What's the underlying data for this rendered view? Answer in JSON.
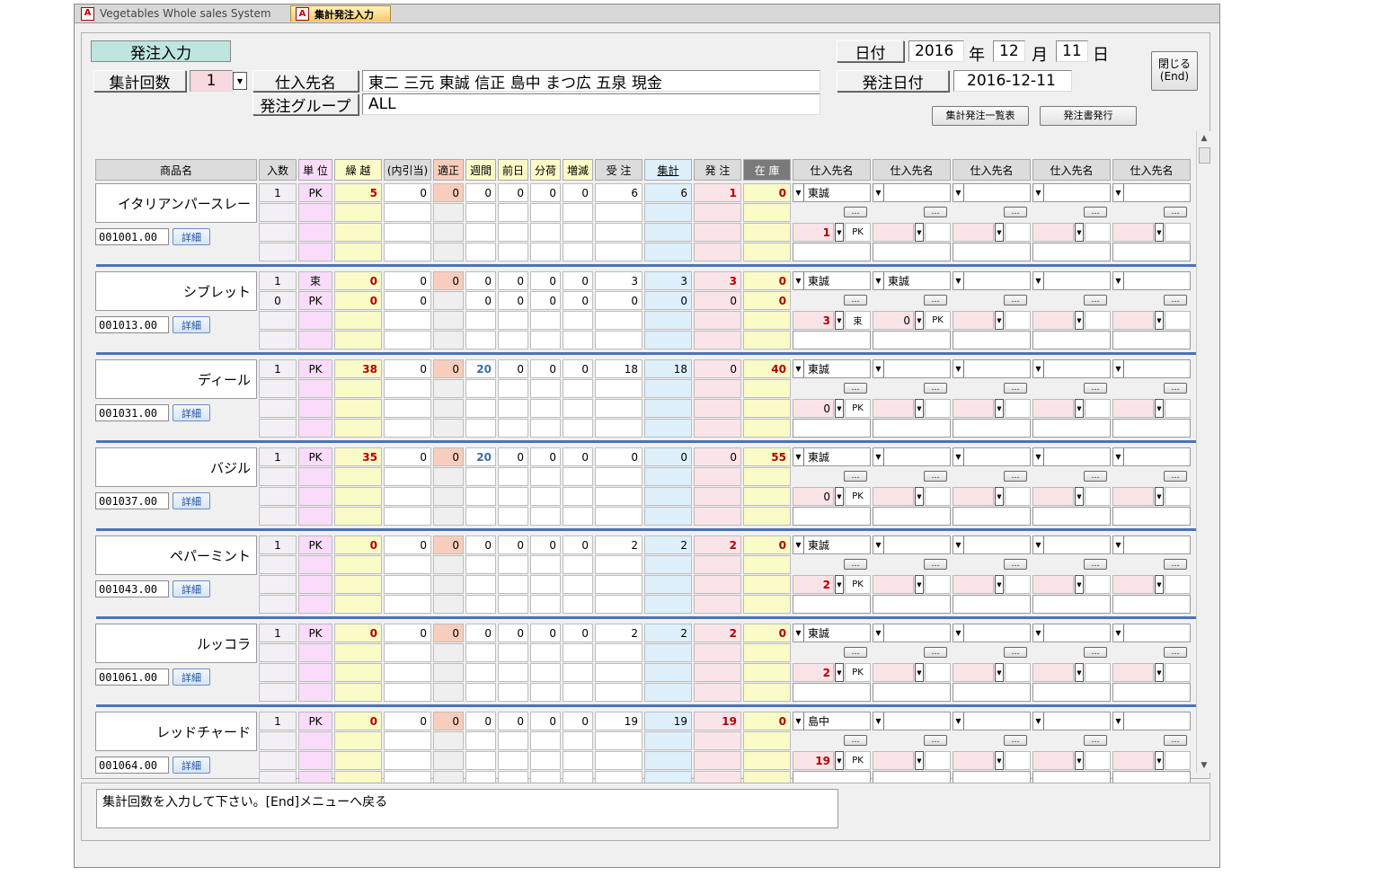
{
  "window": {
    "tabs": [
      {
        "label": "Vegetables Whole sales System",
        "icon": "access-app-icon",
        "active": false
      },
      {
        "label": "集計発注入力",
        "icon": "access-app-icon",
        "active": true
      }
    ]
  },
  "form": {
    "title_label": "発注入力",
    "count_label": "集計回数",
    "count_value": "1",
    "supplier_label": "仕入先名",
    "supplier_value": "東二 三元 東誠 信正 島中 まつ広 五泉 現金",
    "group_label": "発注グループ",
    "group_value": "ALL",
    "date_label": "日付",
    "year": "2016",
    "year_unit": "年",
    "month": "12",
    "month_unit": "月",
    "day": "11",
    "day_unit": "日",
    "order_date_label": "発注日付",
    "order_date_value": "2016-12-11",
    "close_button": "閉じる\n(End)",
    "list_button": "集計発注一覧表",
    "issue_button": "発注書発行",
    "message": "集計回数を入力して下さい。[End]メニューへ戻る"
  },
  "columns": {
    "name": "商品名",
    "irisu": "入数",
    "unit": "単 位",
    "kurikoshi": "繰 越",
    "uchibiki": "(内引当)",
    "tekisei": "適正",
    "shukan": "週間",
    "zenjitsu": "前日",
    "bunka": "分荷",
    "zogen": "増減",
    "juchu": "受 注",
    "shukei": "集計",
    "hatchu": "発 注",
    "zaiko": "在 庫",
    "suppliers": [
      "仕入先名",
      "仕入先名",
      "仕入先名",
      "仕入先名",
      "仕入先名"
    ]
  },
  "labels": {
    "detail": "詳細",
    "ellipsis": "…"
  },
  "products": [
    {
      "name": "イタリアンパースレー",
      "code": "001001.00",
      "lines": [
        {
          "irisu": "1",
          "unit": "PK",
          "kurikoshi": "5",
          "uchibiki": "0",
          "tekisei": "0",
          "shukan": "0",
          "zenjitsu": "0",
          "bunka": "0",
          "zogen": "0",
          "juchu": "6",
          "shukei": "6",
          "hatchu": "1",
          "zaiko": "0"
        }
      ],
      "suppliers": [
        {
          "name": "東誠",
          "qty": "1",
          "unit": "PK"
        },
        {
          "name": "",
          "qty": "",
          "unit": ""
        }
      ]
    },
    {
      "name": "シブレット",
      "code": "001013.00",
      "lines": [
        {
          "irisu": "1",
          "unit": "束",
          "kurikoshi": "0",
          "uchibiki": "0",
          "tekisei": "0",
          "shukan": "0",
          "zenjitsu": "0",
          "bunka": "0",
          "zogen": "0",
          "juchu": "3",
          "shukei": "3",
          "hatchu": "3",
          "zaiko": "0"
        },
        {
          "irisu": "0",
          "unit": "PK",
          "kurikoshi": "0",
          "uchibiki": "0",
          "tekisei": "",
          "shukan": "0",
          "zenjitsu": "0",
          "bunka": "0",
          "zogen": "0",
          "juchu": "0",
          "shukei": "0",
          "hatchu": "0",
          "zaiko": "0"
        }
      ],
      "suppliers": [
        {
          "name": "東誠",
          "qty": "3",
          "unit": "束"
        },
        {
          "name": "東誠",
          "qty": "0",
          "unit": "PK"
        }
      ]
    },
    {
      "name": "ディール",
      "code": "001031.00",
      "lines": [
        {
          "irisu": "1",
          "unit": "PK",
          "kurikoshi": "38",
          "uchibiki": "0",
          "tekisei": "0",
          "shukan": "20",
          "zenjitsu": "0",
          "bunka": "0",
          "zogen": "0",
          "juchu": "18",
          "shukei": "18",
          "hatchu": "0",
          "zaiko": "40"
        }
      ],
      "suppliers": [
        {
          "name": "東誠",
          "qty": "0",
          "unit": "PK"
        },
        {
          "name": "",
          "qty": "",
          "unit": ""
        }
      ]
    },
    {
      "name": "バジル",
      "code": "001037.00",
      "lines": [
        {
          "irisu": "1",
          "unit": "PK",
          "kurikoshi": "35",
          "uchibiki": "0",
          "tekisei": "0",
          "shukan": "20",
          "zenjitsu": "0",
          "bunka": "0",
          "zogen": "0",
          "juchu": "0",
          "shukei": "0",
          "hatchu": "0",
          "zaiko": "55"
        }
      ],
      "suppliers": [
        {
          "name": "東誠",
          "qty": "0",
          "unit": "PK"
        },
        {
          "name": "",
          "qty": "",
          "unit": ""
        }
      ]
    },
    {
      "name": "ペパーミント",
      "code": "001043.00",
      "lines": [
        {
          "irisu": "1",
          "unit": "PK",
          "kurikoshi": "0",
          "uchibiki": "0",
          "tekisei": "0",
          "shukan": "0",
          "zenjitsu": "0",
          "bunka": "0",
          "zogen": "0",
          "juchu": "2",
          "shukei": "2",
          "hatchu": "2",
          "zaiko": "0"
        }
      ],
      "suppliers": [
        {
          "name": "東誠",
          "qty": "2",
          "unit": "PK"
        },
        {
          "name": "",
          "qty": "",
          "unit": ""
        }
      ]
    },
    {
      "name": "ルッコラ",
      "code": "001061.00",
      "lines": [
        {
          "irisu": "1",
          "unit": "PK",
          "kurikoshi": "0",
          "uchibiki": "0",
          "tekisei": "0",
          "shukan": "0",
          "zenjitsu": "0",
          "bunka": "0",
          "zogen": "0",
          "juchu": "2",
          "shukei": "2",
          "hatchu": "2",
          "zaiko": "0"
        }
      ],
      "suppliers": [
        {
          "name": "東誠",
          "qty": "2",
          "unit": "PK"
        },
        {
          "name": "",
          "qty": "",
          "unit": ""
        }
      ]
    },
    {
      "name": "レッドチャード",
      "code": "001064.00",
      "lines": [
        {
          "irisu": "1",
          "unit": "PK",
          "kurikoshi": "0",
          "uchibiki": "0",
          "tekisei": "0",
          "shukan": "0",
          "zenjitsu": "0",
          "bunka": "0",
          "zogen": "0",
          "juchu": "19",
          "shukei": "19",
          "hatchu": "19",
          "zaiko": "0"
        }
      ],
      "suppliers": [
        {
          "name": "島中",
          "qty": "19",
          "unit": "PK"
        },
        {
          "name": "",
          "qty": "",
          "unit": ""
        }
      ]
    }
  ]
}
